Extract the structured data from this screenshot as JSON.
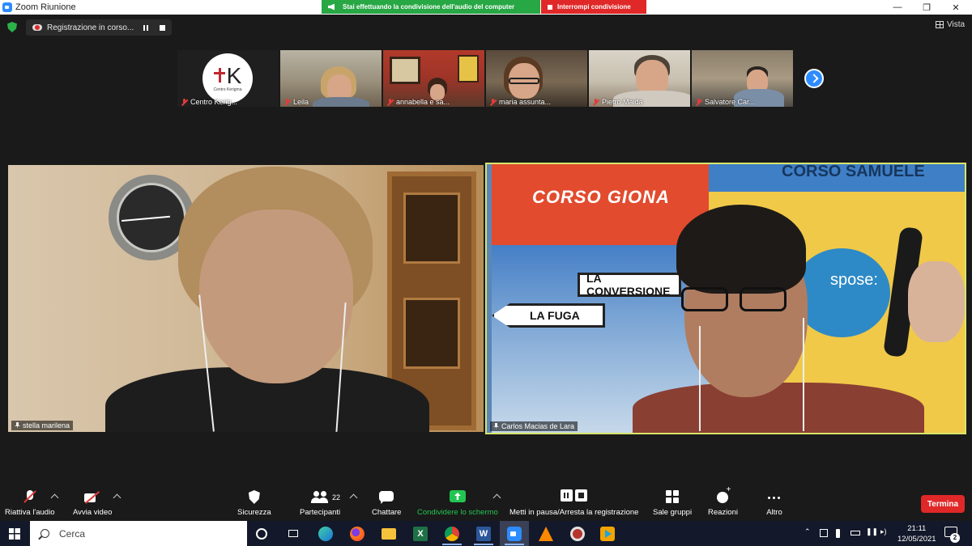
{
  "window": {
    "title": "Zoom Riunione",
    "controls": [
      "minimize-icon",
      "restore-icon",
      "close-icon"
    ]
  },
  "share_banner": {
    "message": "Stai effettuando la condivisione dell'audio del computer",
    "stop_label": "Interrompi condivisione",
    "color": "#28a745",
    "stop_color": "#e02828"
  },
  "recording": {
    "label": "Registrazione in corso..."
  },
  "view": {
    "label": "Vista"
  },
  "thumbnails": [
    {
      "name": "Centro Kerig...",
      "muted": true,
      "logo_letter": "K",
      "logo_sub": "Centro Kerigma"
    },
    {
      "name": "Leila",
      "muted": true
    },
    {
      "name": "annabella e sa...",
      "muted": true
    },
    {
      "name": "maria assunta...",
      "muted": true
    },
    {
      "name": "Pietro Maida",
      "muted": true
    },
    {
      "name": "Salvatore Car...",
      "muted": true
    }
  ],
  "main_videos": [
    {
      "name": "stella marilena",
      "pinned": true
    },
    {
      "name": "Carlos Macias de Lara",
      "pinned": true,
      "active_speaker": true,
      "banner_left": "CORSO GIONA",
      "banner_top": "CORSO SAMUELE",
      "sign_1": "LA CONVERSIONE",
      "sign_2": "LA FUGA",
      "bubble": "spose:"
    }
  ],
  "active_speaker_color": "#d7e56a",
  "toolbar": {
    "audio_label": "Riattiva l'audio",
    "video_label": "Avvia video",
    "security_label": "Sicurezza",
    "participants_label": "Partecipanti",
    "participants_count": "22",
    "chat_label": "Chattare",
    "share_label": "Condividere lo schermo",
    "record_label": "Metti in pausa/Arresta la registrazione",
    "breakout_label": "Sale gruppi",
    "reactions_label": "Reazioni",
    "more_label": "Altro",
    "end_label": "Termina",
    "share_color": "#23c552",
    "end_color": "#e02828"
  },
  "taskbar": {
    "search_placeholder": "Cerca",
    "apps": [
      "task-view-icon",
      "timeline-icon",
      "edge-icon",
      "firefox-icon",
      "file-explorer-icon",
      "excel-icon",
      "chrome-icon",
      "word-icon",
      "zoom-icon",
      "vlc-icon",
      "media-icon",
      "player-icon"
    ],
    "time": "21:11",
    "date": "12/05/2021",
    "notifications": "2"
  }
}
